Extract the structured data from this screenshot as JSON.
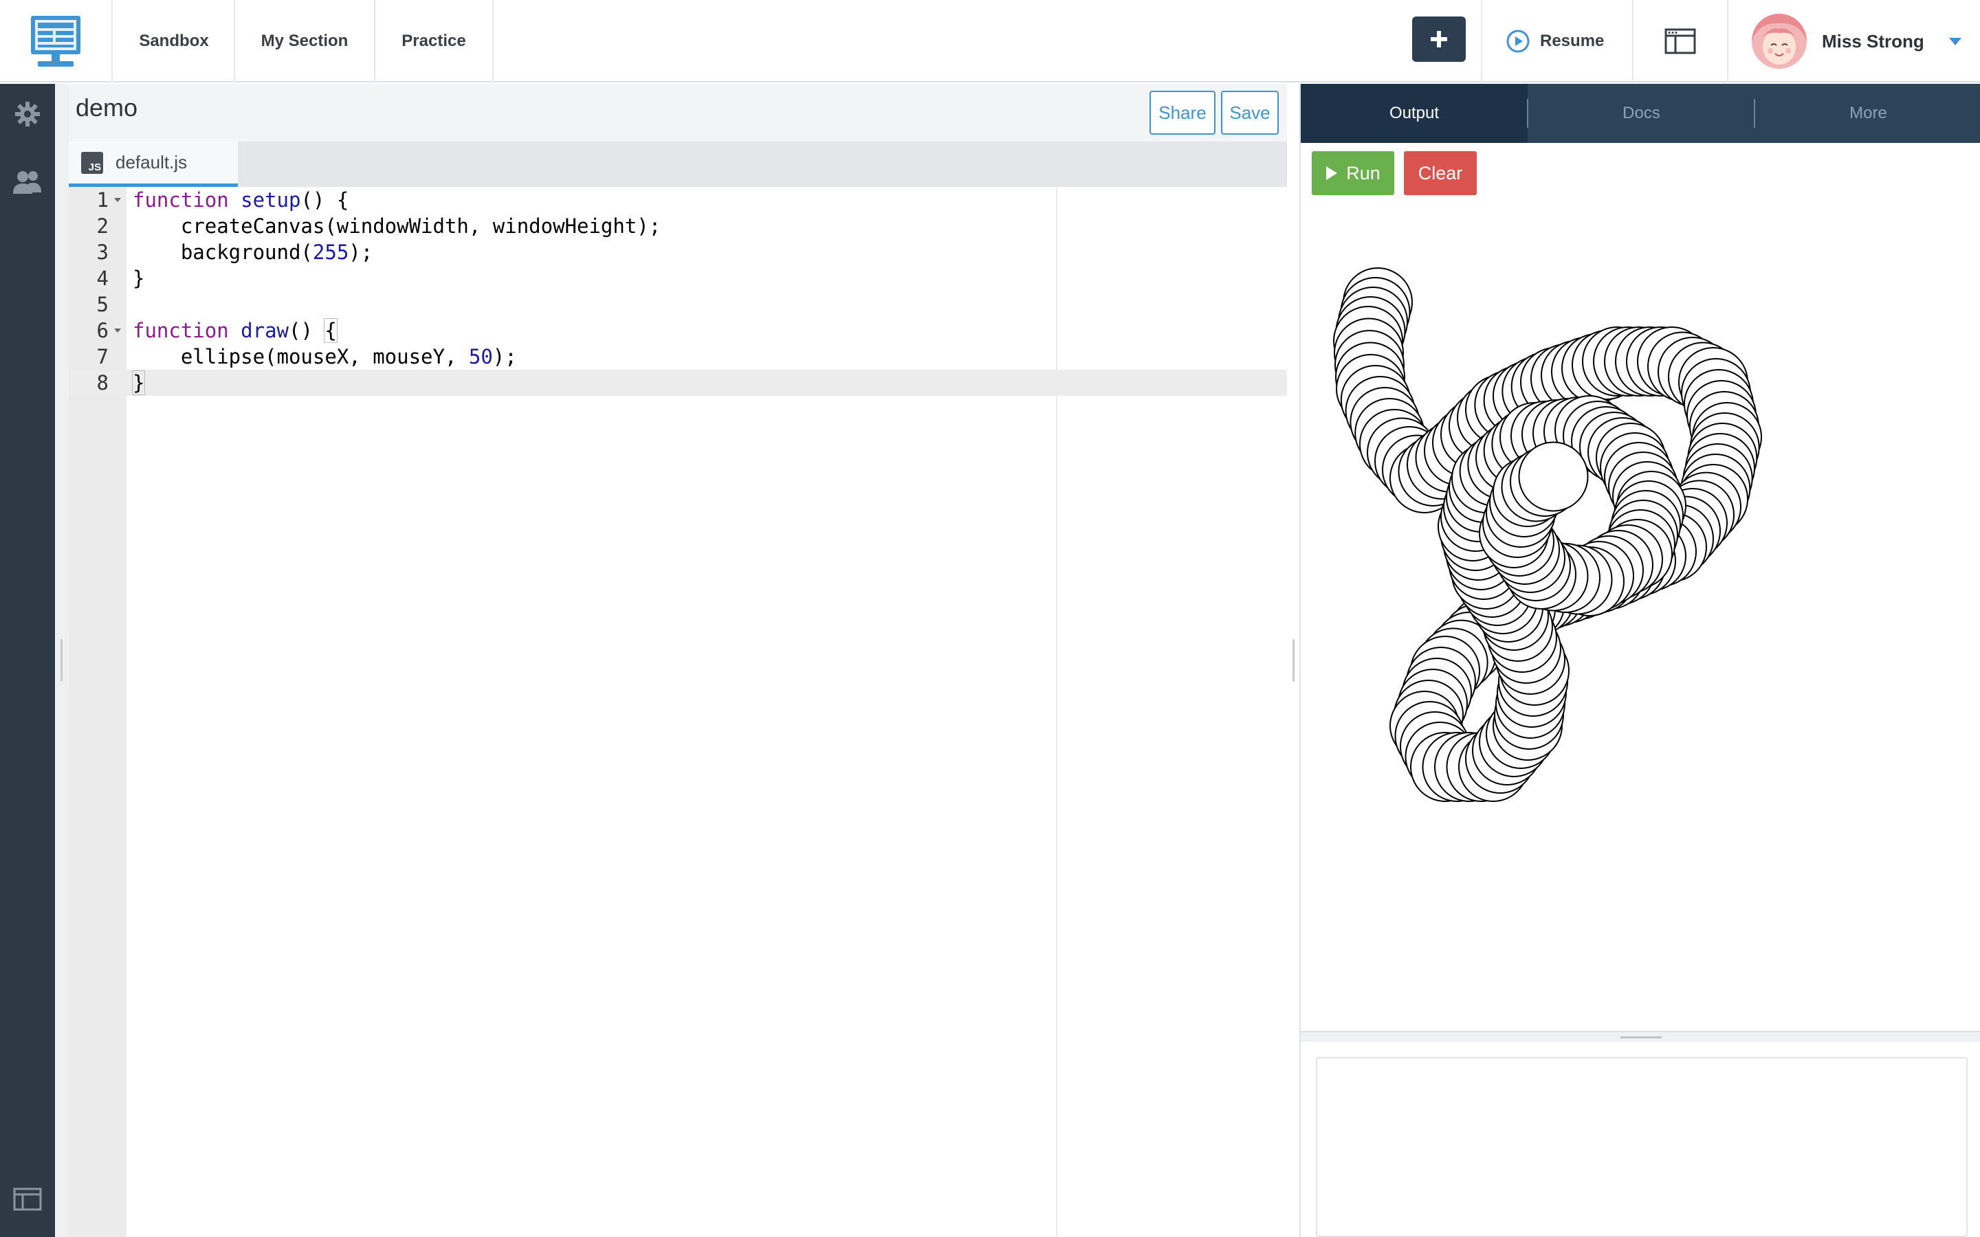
{
  "nav": {
    "items": [
      "Sandbox",
      "My Section",
      "Practice"
    ],
    "resume_label": "Resume",
    "user_name": "Miss Strong"
  },
  "project": {
    "title": "demo",
    "share_label": "Share",
    "save_label": "Save",
    "file_tab": "default.js",
    "file_badge": "JS"
  },
  "editor": {
    "line_numbers": [
      "1",
      "2",
      "3",
      "4",
      "5",
      "6",
      "7",
      "8"
    ],
    "active_line": 8
  },
  "output": {
    "tabs": [
      "Output",
      "Docs",
      "More"
    ],
    "active_tab": "Output",
    "run_label": "Run",
    "clear_label": "Clear"
  },
  "colors": {
    "sidebar": "#2d3a46",
    "accent": "#3d95d3",
    "run": "#6ab04c",
    "clear": "#d9534f",
    "tab_bar": "#2d4458"
  },
  "icons": {
    "logo": "monitor-icon",
    "plus": "plus-icon",
    "resume": "play-circle-icon",
    "browser": "browser-window-icon",
    "settings": "gear-icon",
    "users": "users-icon",
    "layout": "layout-icon"
  }
}
